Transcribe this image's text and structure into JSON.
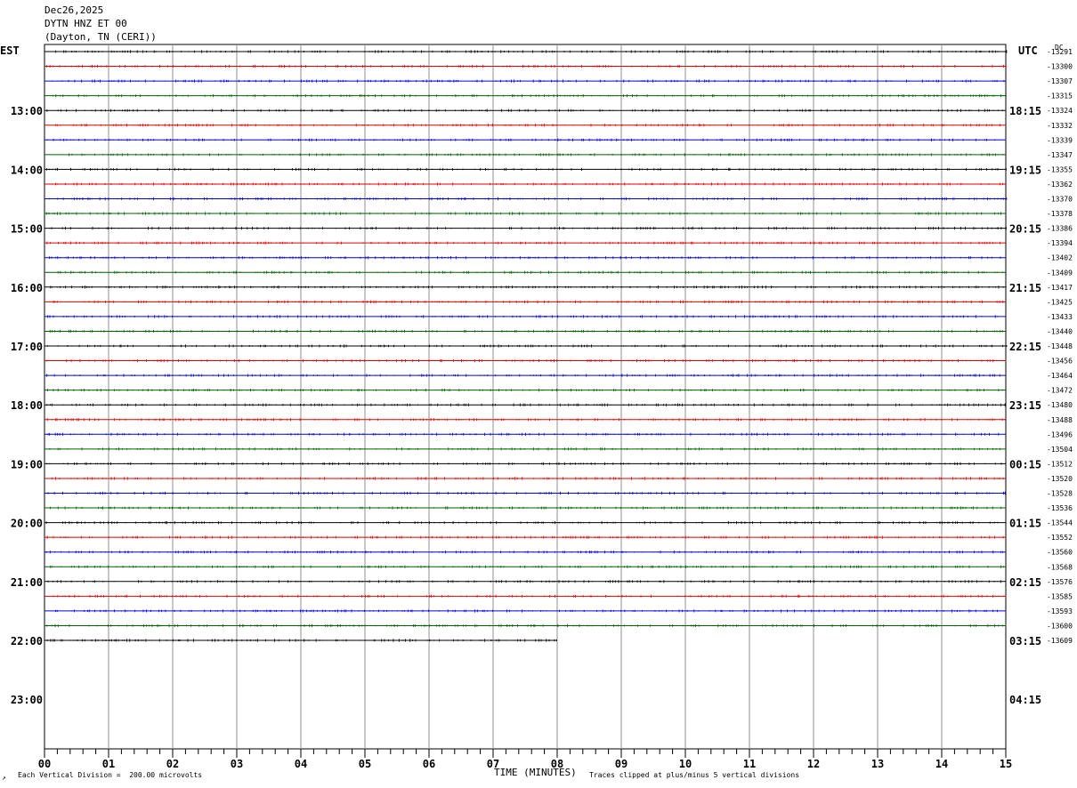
{
  "header": {
    "date": "Dec26,2025",
    "station": "DYTN HNZ ET 00",
    "location": "(Dayton, TN (CERI))"
  },
  "left_zone": "EST",
  "right_zone": "UTC",
  "dc_label": "DC",
  "est_hours": [
    "13:00",
    "14:00",
    "15:00",
    "16:00",
    "17:00",
    "18:00",
    "19:00",
    "20:00",
    "21:00",
    "22:00",
    "23:00"
  ],
  "utc_hours": [
    "18:15",
    "19:15",
    "20:15",
    "21:15",
    "22:15",
    "23:15",
    "00:15",
    "01:15",
    "02:15",
    "03:15",
    "04:15"
  ],
  "dc_offsets": [
    "-13291",
    "-13300",
    "-13307",
    "-13315",
    "-13324",
    "-13332",
    "-13339",
    "-13347",
    "-13355",
    "-13362",
    "-13370",
    "-13378",
    "-13386",
    "-13394",
    "-13402",
    "-13409",
    "-13417",
    "-13425",
    "-13433",
    "-13440",
    "-13448",
    "-13456",
    "-13464",
    "-13472",
    "-13480",
    "-13488",
    "-13496",
    "-13504",
    "-13512",
    "-13520",
    "-13528",
    "-13536",
    "-13544",
    "-13552",
    "-13560",
    "-13568",
    "-13576",
    "-13585",
    "-13593",
    "-13600",
    "-13609"
  ],
  "x_ticks": [
    "00",
    "01",
    "02",
    "03",
    "04",
    "05",
    "06",
    "07",
    "08",
    "09",
    "10",
    "11",
    "12",
    "13",
    "14",
    "15"
  ],
  "footer": {
    "scale_note": "Each Vertical Division =  200.00 microvolts",
    "axis_title": "TIME (MINUTES)",
    "clip_note": "Traces clipped at plus/minus 5 vertical divisions"
  },
  "chart_data": {
    "type": "line",
    "title": "DYTN HNZ ET 00",
    "xlabel": "TIME (MINUTES)",
    "xlim": [
      0,
      15
    ],
    "x_major_step": 1,
    "x_minor_step": 0.2,
    "trace_interval_minutes": 15,
    "traces_per_hour": 4,
    "trace_colors": [
      "#000000",
      "#e00000",
      "#0000e0",
      "#006000"
    ],
    "trace_count": 41,
    "last_trace_end_minute": 8,
    "grid": true
  }
}
